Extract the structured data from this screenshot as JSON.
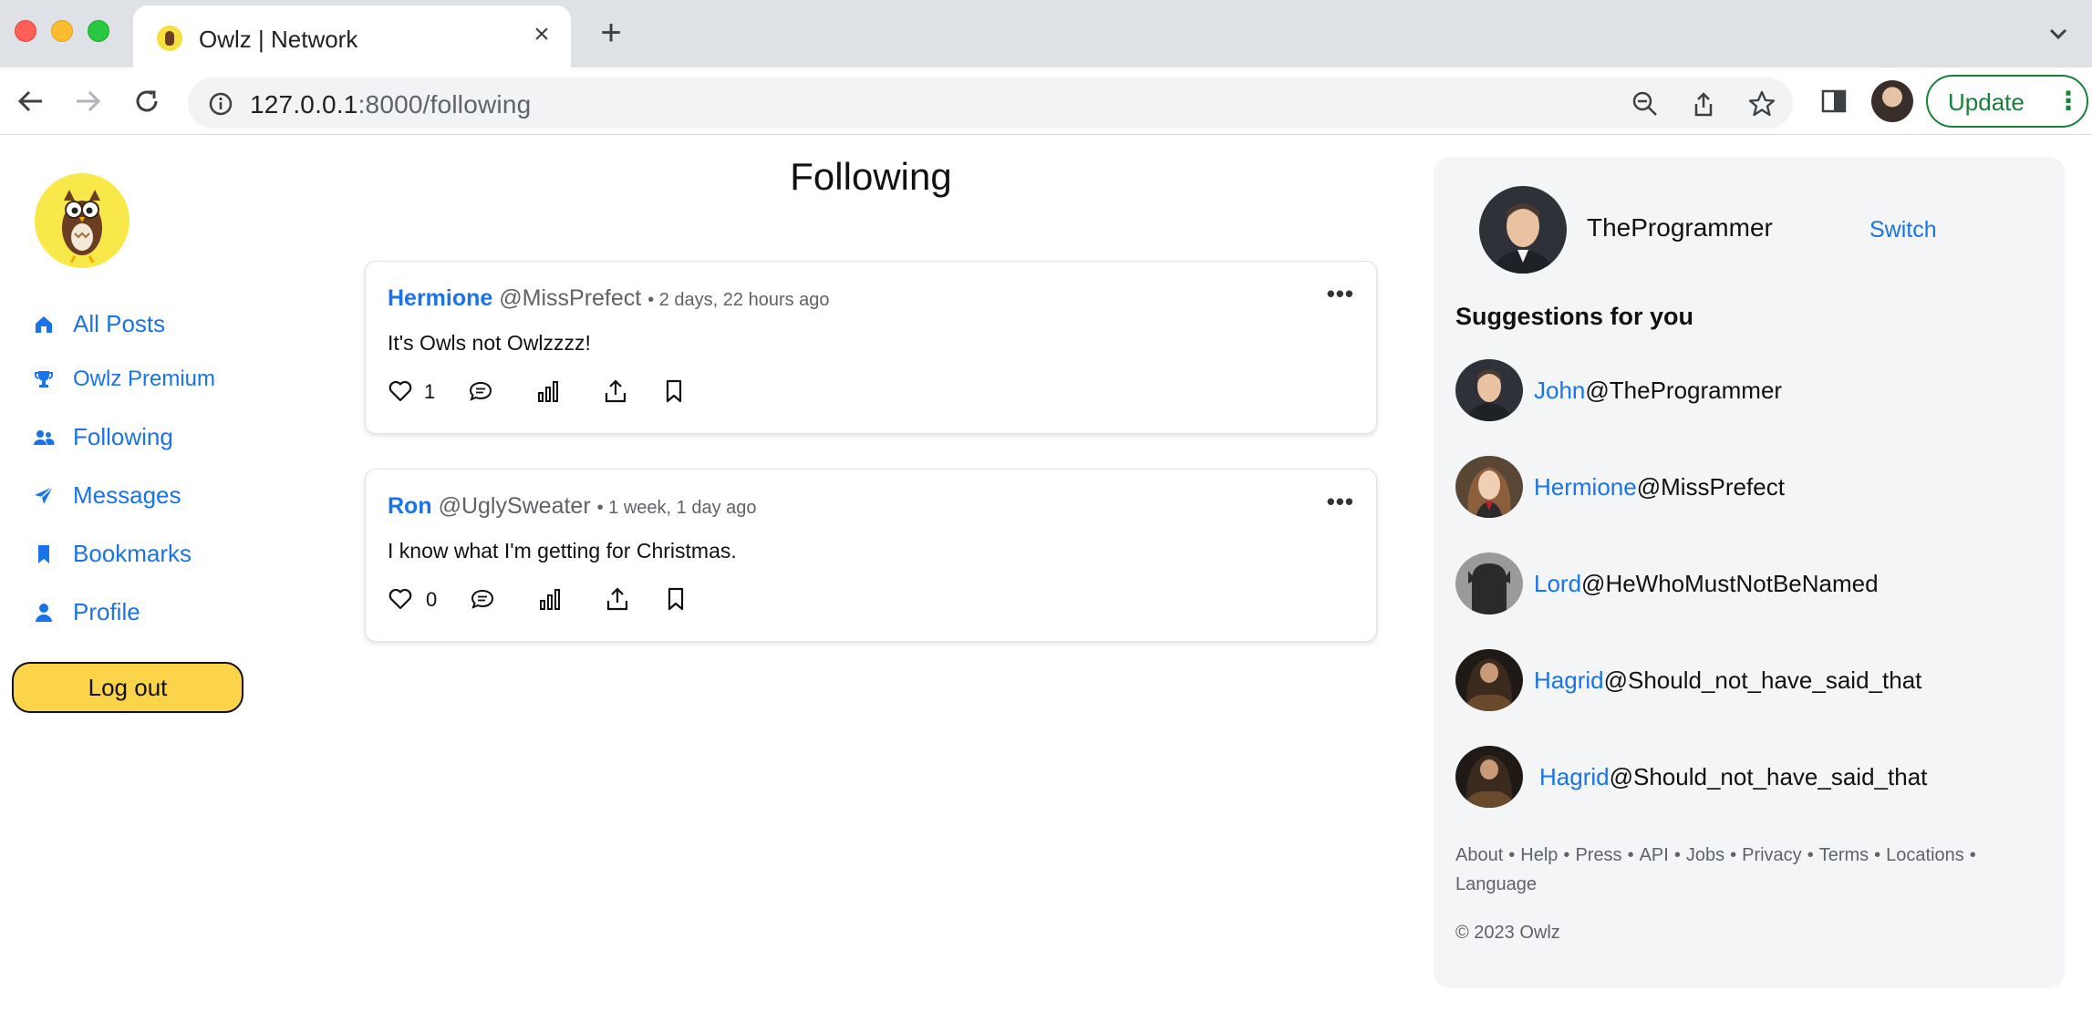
{
  "browser": {
    "tab_title": "Owlz | Network",
    "url_host": "127.0.0.1",
    "url_rest": ":8000/following",
    "update_label": "Update"
  },
  "sidebar": {
    "items": [
      {
        "label": "All Posts",
        "icon": "home-icon"
      },
      {
        "label": "Owlz Premium",
        "icon": "trophy-icon"
      },
      {
        "label": "Following",
        "icon": "users-icon"
      },
      {
        "label": "Messages",
        "icon": "paper-plane-icon"
      },
      {
        "label": "Bookmarks",
        "icon": "bookmark-icon"
      },
      {
        "label": "Profile",
        "icon": "user-icon"
      }
    ],
    "logout_label": "Log out"
  },
  "feed": {
    "title": "Following",
    "posts": [
      {
        "author": "Hermione",
        "handle": "@MissPrefect",
        "time": "• 2 days, 22 hours ago",
        "body": "It's Owls not Owlzzzz!",
        "likes": "1"
      },
      {
        "author": "Ron",
        "handle": "@UglySweater",
        "time": "• 1 week, 1 day ago",
        "body": "I know what I'm getting for Christmas.",
        "likes": "0"
      }
    ]
  },
  "account": {
    "username": "TheProgrammer",
    "switch_label": "Switch"
  },
  "suggestions": {
    "title": "Suggestions for you",
    "items": [
      {
        "name": "John",
        "handle": "@TheProgrammer"
      },
      {
        "name": "Hermione",
        "handle": "@MissPrefect"
      },
      {
        "name": "Lord",
        "handle": "@HeWhoMustNotBeNamed"
      },
      {
        "name": "Hagrid",
        "handle": "@Should_not_have_said_that"
      },
      {
        "name": "Hagrid",
        "handle": "@Should_not_have_said_that"
      }
    ]
  },
  "footer": {
    "links": [
      "About",
      "Help",
      "Press",
      "API",
      "Jobs",
      "Privacy",
      "Terms",
      "Locations",
      "Language"
    ],
    "copyright": "© 2023 Owlz"
  },
  "colors": {
    "link": "#1a73e8",
    "logout_bg": "#fbd44a",
    "right_panel_bg": "#f4f5f7"
  }
}
